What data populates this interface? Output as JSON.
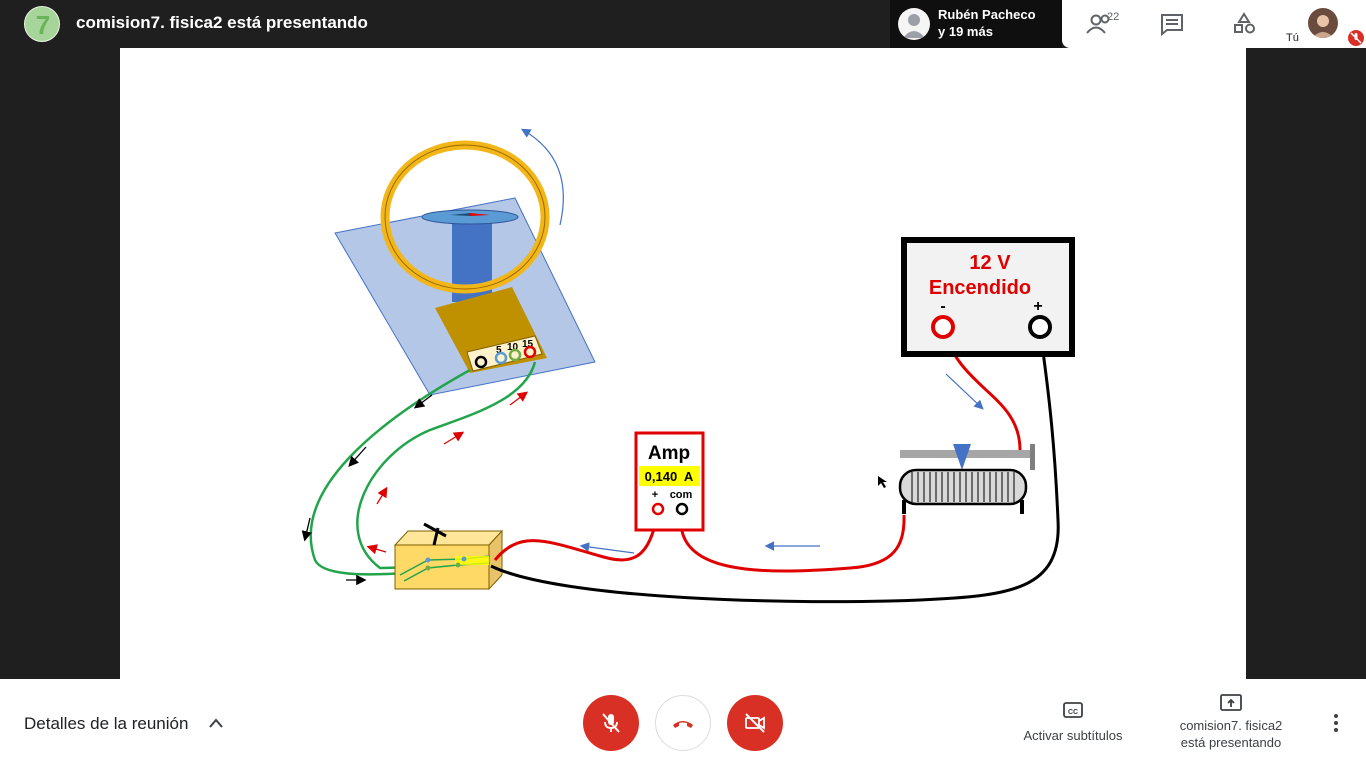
{
  "header": {
    "logo_glyph": "7",
    "presenting_title": "comision7. fisica2 está presentando",
    "presenter_name": "Rubén Pacheco",
    "presenter_more": "y 19 más",
    "participants_count": "22",
    "self_label": "Tú"
  },
  "icons": {
    "people": "people-icon",
    "chat": "chat-icon",
    "activities": "activities-icon",
    "mic_off": "mic-off-icon",
    "hangup": "hangup-icon",
    "cam_off": "camera-off-icon",
    "captions": "captions-icon",
    "present": "present-icon",
    "more": "more-vert-icon"
  },
  "slide": {
    "source_value": "12 V",
    "source_state": "Encendido",
    "source_minus": "-",
    "source_plus": "+",
    "amp_title": "Amp",
    "amp_reading": "0,140  A",
    "amp_plus": "+",
    "amp_com": "com",
    "coil_turns": [
      "5",
      "10",
      "15"
    ]
  },
  "footer": {
    "details": "Detalles de la reunión",
    "captions": "Activar subtítulos",
    "presenting_line1": "comision7. fisica2",
    "presenting_line2": "está presentando"
  },
  "colors": {
    "danger": "#d93025",
    "wire_red": "#e00000",
    "wire_green": "#22a44a",
    "ring_gold": "#f3b619",
    "platform_blue": "#b4c7e7"
  }
}
